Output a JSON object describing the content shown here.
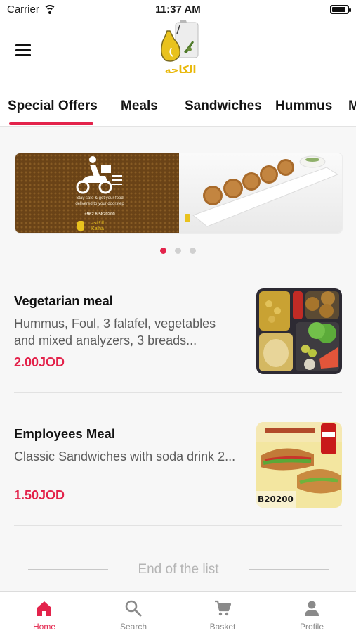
{
  "status_bar": {
    "carrier": "Carrier",
    "time": "11:37 AM",
    "battery_level": 0.9
  },
  "header": {
    "menu_icon": "hamburger-menu-icon",
    "logo": {
      "icon": "falafel-shop-logo",
      "text": "الكاحه"
    }
  },
  "tabs": [
    {
      "label": "Special Offers",
      "active": true
    },
    {
      "label": "Meals",
      "active": false
    },
    {
      "label": "Sandwiches",
      "active": false
    },
    {
      "label": "Hummus",
      "active": false
    },
    {
      "label": "M",
      "active": false
    }
  ],
  "banner": {
    "icon": "delivery-scooter-icon",
    "text_line1": "Stay safe & get your food",
    "text_line2": "delivered to your doorstep",
    "phone": "+962 6 5820200",
    "brand_ar": "الكاحه",
    "brand_en": "Kalha",
    "slides_count": 3,
    "active_slide": 1
  },
  "items": [
    {
      "name": "Vegetarian meal",
      "description": "Hummus, Foul, 3 falafel, vegetables and mixed analyzers, 3 breads...",
      "price": "2.00JOD",
      "image": "vegetarian-meal-photo"
    },
    {
      "name": "Employees Meal",
      "description": "Classic Sandwiches with soda drink 2...",
      "price": "1.50JOD",
      "image": "employees-meal-photo",
      "image_text": "B20200"
    }
  ],
  "end_of_list": "End of the list",
  "bottom_nav": [
    {
      "label": "Home",
      "icon": "home-icon",
      "active": true
    },
    {
      "label": "Search",
      "icon": "search-icon",
      "active": false
    },
    {
      "label": "Basket",
      "icon": "cart-icon",
      "active": false
    },
    {
      "label": "Profile",
      "icon": "profile-icon",
      "active": false
    }
  ],
  "colors": {
    "accent": "#e3234b",
    "brand_yellow": "#e9c21d",
    "banner_brown": "#6a4317"
  }
}
